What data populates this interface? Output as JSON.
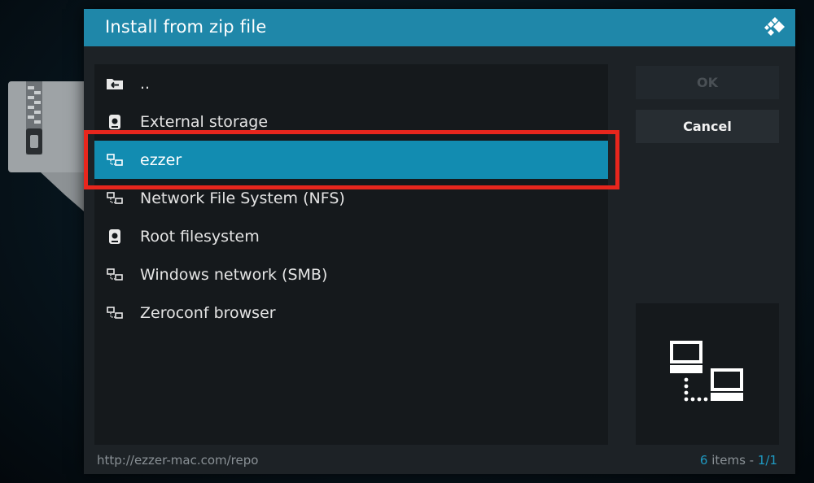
{
  "dialog": {
    "title": "Install from zip file",
    "logo_icon": "kodi-logo-icon"
  },
  "list": {
    "items": [
      {
        "label": "..",
        "icon": "folder-back-icon"
      },
      {
        "label": "External storage",
        "icon": "hard-drive-icon"
      },
      {
        "label": "ezzer",
        "icon": "network-icon",
        "selected": true
      },
      {
        "label": "Network File System (NFS)",
        "icon": "network-icon"
      },
      {
        "label": "Root filesystem",
        "icon": "hard-drive-icon"
      },
      {
        "label": "Windows network (SMB)",
        "icon": "network-icon"
      },
      {
        "label": "Zeroconf browser",
        "icon": "network-icon"
      }
    ]
  },
  "buttons": {
    "ok_label": "OK",
    "cancel_label": "Cancel"
  },
  "preview": {
    "icon": "network-large-icon"
  },
  "footer": {
    "path": "http://ezzer-mac.com/repo",
    "count": "6",
    "count_suffix": " items - ",
    "page": "1/1"
  },
  "colors": {
    "header": "#1f87a9",
    "selected": "#128cb1",
    "highlight_border": "#e8261d",
    "accent": "#1f9ac2"
  }
}
